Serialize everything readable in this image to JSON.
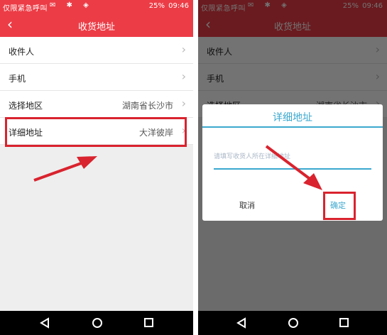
{
  "status_bar": {
    "carrier": "仅限紧急呼叫",
    "icons": [
      "notification-icon",
      "bluetooth-icon",
      "wifi-icon",
      "signal-icon"
    ],
    "battery": "25%",
    "time": "09:46"
  },
  "header": {
    "title": "收货地址"
  },
  "form": {
    "rows": [
      {
        "label": "收件人",
        "value": ""
      },
      {
        "label": "手机",
        "value": ""
      },
      {
        "label": "选择地区",
        "value": "湖南省长沙市"
      },
      {
        "label": "详细地址",
        "value": "大洋彼岸"
      }
    ]
  },
  "dialog": {
    "title": "详细地址",
    "placeholder": "请填写收货人所在详细地址",
    "cancel": "取消",
    "confirm": "确定"
  },
  "colors": {
    "accent_red": "#ec3c46",
    "dialog_blue": "#3ba8cf",
    "annotation_red": "#d9232e"
  }
}
